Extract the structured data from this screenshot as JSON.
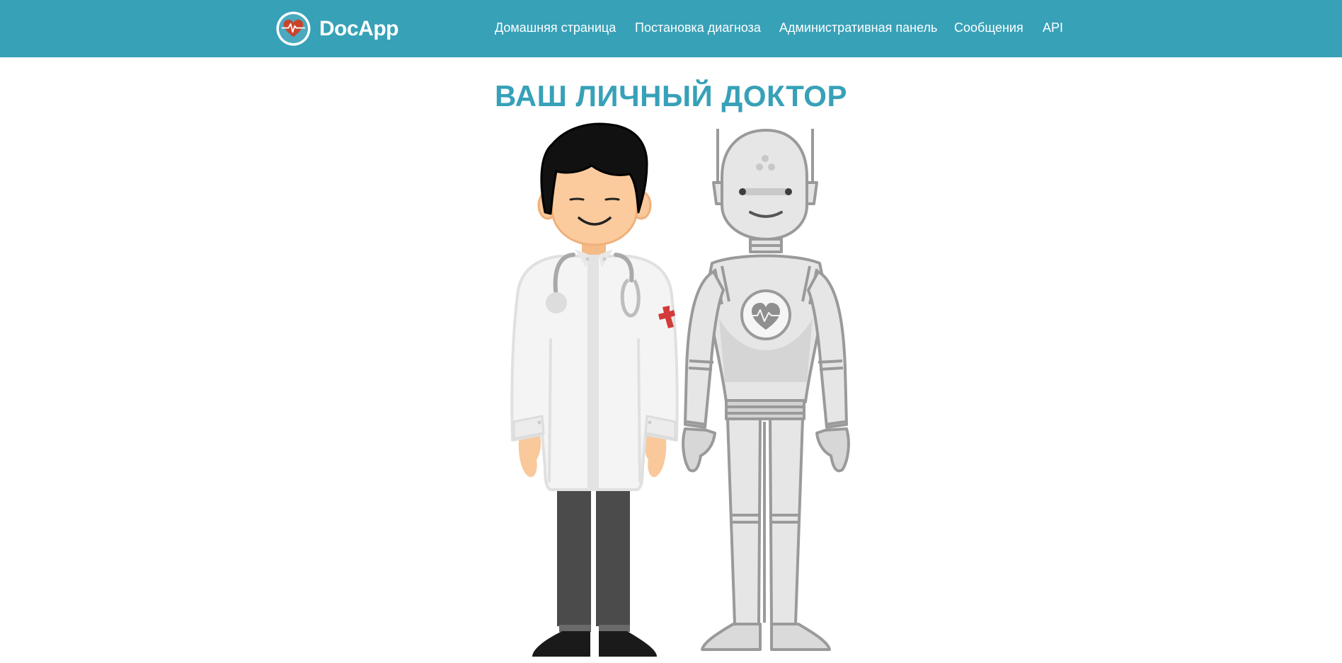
{
  "navbar": {
    "brand": {
      "name": "DocApp",
      "logo_icon": "heart-pulse-icon"
    },
    "links": [
      {
        "label": "Домашняя страница"
      },
      {
        "label": "Постановка диагноза"
      },
      {
        "label": "Административная панель"
      },
      {
        "label": "Сообщения"
      },
      {
        "label": "API"
      }
    ]
  },
  "hero": {
    "title": "ВАШ ЛИЧНЫЙ ДОКТОР",
    "illustration": [
      "doctor-figure",
      "robot-figure"
    ]
  },
  "colors": {
    "primary": "#37a1b8",
    "heart_red": "#c9432b",
    "text_light": "#ffffff"
  }
}
